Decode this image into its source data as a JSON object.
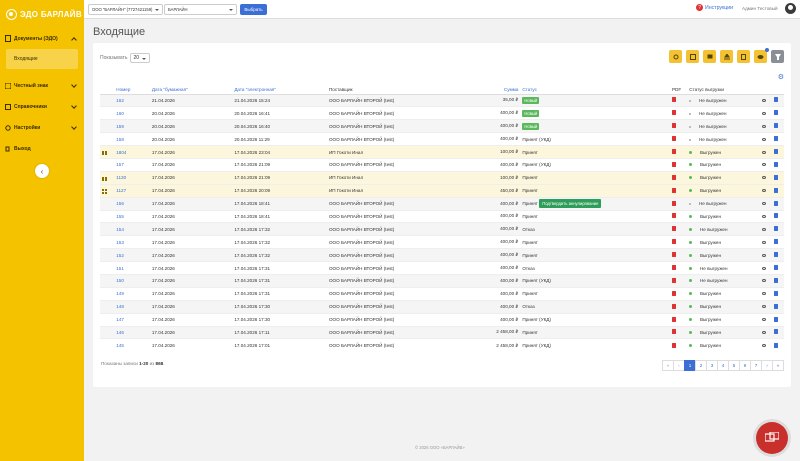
{
  "brand": {
    "name": "ЭДО БАРЛАЙВ"
  },
  "sidebar": {
    "items": [
      {
        "label": "Документы (ЭДО)",
        "icon": "document-icon"
      },
      {
        "label": "Входящие"
      },
      {
        "label": "Честный знак",
        "icon": "mark-icon"
      },
      {
        "label": "Справочники",
        "icon": "book-icon"
      },
      {
        "label": "Настройки",
        "icon": "settings-icon"
      },
      {
        "label": "Выход",
        "icon": "logout-icon"
      }
    ]
  },
  "topbar": {
    "org_select": "ООО \"БАРЛАЙН\" (7727421159)",
    "unit_select": "БАРЛАЙН",
    "choose_button": "Выбрать",
    "instructions": "Инструкции",
    "user": "Админ Тестовый"
  },
  "page": {
    "title": "Входящие"
  },
  "list": {
    "show_label": "Показывать",
    "page_size": "20",
    "columns": [
      "Номер",
      "Дата \"бумажная\"",
      "Дата \"электронная\"",
      "Поставщик",
      "Сумма",
      "Статус",
      "PDF",
      "Статус выгрузки"
    ],
    "rows": [
      {
        "num": "162",
        "d1": "21.04.2026",
        "d2": "21.04.2026 15:24",
        "sup": "ООО БАРЛАЙН ВТОРОЙ (test)",
        "sum": "35,00 ₽",
        "status": "Новый",
        "badge": true,
        "st_icon": false,
        "exp": "Не выгружен",
        "hl": false
      },
      {
        "num": "160",
        "d1": "20.04.2026",
        "d2": "20.04.2026 16:41",
        "sup": "ООО БАРЛАЙН ВТОРОЙ (test)",
        "sum": "400,00 ₽",
        "status": "Новый",
        "badge": true,
        "st_icon": false,
        "exp": "Не выгружен",
        "hl": false
      },
      {
        "num": "159",
        "d1": "20.04.2026",
        "d2": "20.04.2026 16:40",
        "sup": "ООО БАРЛАЙН ВТОРОЙ (test)",
        "sum": "400,00 ₽",
        "status": "Новый",
        "badge": true,
        "st_icon": false,
        "exp": "Не выгружен",
        "hl": false
      },
      {
        "num": "158",
        "d1": "20.04.2026",
        "d2": "20.04.2026 11:29",
        "sup": "ООО БАРЛАЙН ВТОРОЙ (test)",
        "sum": "400,00 ₽",
        "status": "Принят (УКД)",
        "badge": false,
        "st_icon": false,
        "exp": "Не выгружен",
        "hl": false
      },
      {
        "num": "1804",
        "d1": "17.04.2026",
        "d2": "17.04.2026 23:04",
        "sup": "ИП Гокоти Инал",
        "sum": "100,00 ₽",
        "status": "Принят",
        "badge": false,
        "st_icon": true,
        "exp": "Выгружен",
        "hl": true
      },
      {
        "num": "157",
        "d1": "17.04.2026",
        "d2": "17.04.2026 21:09",
        "sup": "ООО БАРЛАЙН ВТОРОЙ (test)",
        "sum": "400,00 ₽",
        "status": "Принят (УКД)",
        "badge": false,
        "st_icon": true,
        "exp": "Выгружен",
        "hl": false
      },
      {
        "num": "1130",
        "d1": "17.04.2026",
        "d2": "17.04.2026 21:09",
        "sup": "ИП Гокоти Инал",
        "sum": "100,00 ₽",
        "status": "Принят",
        "badge": false,
        "st_icon": true,
        "exp": "Выгружен",
        "hl": true
      },
      {
        "num": "1127",
        "d1": "17.04.2026",
        "d2": "17.04.2026 20:09",
        "sup": "ИП Гокоти Инал",
        "sum": "450,00 ₽",
        "status": "Принят",
        "badge": false,
        "st_icon": true,
        "exp": "Выгружен",
        "hl": true
      },
      {
        "num": "156",
        "d1": "17.04.2026",
        "d2": "17.04.2026 18:41",
        "sup": "ООО БАРЛАЙН ВТОРОЙ (test)",
        "sum": "400,00 ₽",
        "status": "Принят",
        "badge": false,
        "st_icon": false,
        "exp": "Не выгружен",
        "hl": false,
        "action": "Подтвердить аннулирование"
      },
      {
        "num": "155",
        "d1": "17.04.2026",
        "d2": "17.04.2026 18:41",
        "sup": "ООО БАРЛАЙН ВТОРОЙ (test)",
        "sum": "400,00 ₽",
        "status": "Принят",
        "badge": false,
        "st_icon": true,
        "exp": "Выгружен",
        "hl": false
      },
      {
        "num": "154",
        "d1": "17.04.2026",
        "d2": "17.04.2026 17:32",
        "sup": "ООО БАРЛАЙН ВТОРОЙ (test)",
        "sum": "400,00 ₽",
        "status": "Отказ",
        "badge": false,
        "st_icon": true,
        "exp": "Не выгружен",
        "hl": false
      },
      {
        "num": "153",
        "d1": "17.04.2026",
        "d2": "17.04.2026 17:32",
        "sup": "ООО БАРЛАЙН ВТОРОЙ (test)",
        "sum": "400,00 ₽",
        "status": "Принят",
        "badge": false,
        "st_icon": true,
        "exp": "Выгружен",
        "hl": false
      },
      {
        "num": "152",
        "d1": "17.04.2026",
        "d2": "17.04.2026 17:32",
        "sup": "ООО БАРЛАЙН ВТОРОЙ (test)",
        "sum": "400,00 ₽",
        "status": "Принят",
        "badge": false,
        "st_icon": true,
        "exp": "Выгружен",
        "hl": false
      },
      {
        "num": "151",
        "d1": "17.04.2026",
        "d2": "17.04.2026 17:31",
        "sup": "ООО БАРЛАЙН ВТОРОЙ (test)",
        "sum": "400,00 ₽",
        "status": "Отказ",
        "badge": false,
        "st_icon": true,
        "exp": "Не выгружен",
        "hl": false
      },
      {
        "num": "150",
        "d1": "17.04.2026",
        "d2": "17.04.2026 17:31",
        "sup": "ООО БАРЛАЙН ВТОРОЙ (test)",
        "sum": "400,00 ₽",
        "status": "Принят (УКД)",
        "badge": false,
        "st_icon": true,
        "exp": "Не выгружен",
        "hl": false
      },
      {
        "num": "149",
        "d1": "17.04.2026",
        "d2": "17.04.2026 17:31",
        "sup": "ООО БАРЛАЙН ВТОРОЙ (test)",
        "sum": "400,00 ₽",
        "status": "Принят",
        "badge": false,
        "st_icon": true,
        "exp": "Выгружен",
        "hl": false
      },
      {
        "num": "148",
        "d1": "17.04.2026",
        "d2": "17.04.2026 17:30",
        "sup": "ООО БАРЛАЙН ВТОРОЙ (test)",
        "sum": "400,00 ₽",
        "status": "Отказ",
        "badge": false,
        "st_icon": true,
        "exp": "Выгружен",
        "hl": false
      },
      {
        "num": "147",
        "d1": "17.04.2026",
        "d2": "17.04.2026 17:30",
        "sup": "ООО БАРЛАЙН ВТОРОЙ (test)",
        "sum": "400,00 ₽",
        "status": "Принят (УКД)",
        "badge": false,
        "st_icon": true,
        "exp": "Выгружен",
        "hl": false
      },
      {
        "num": "146",
        "d1": "17.04.2026",
        "d2": "17.04.2026 17:11",
        "sup": "ООО БАРЛАЙН ВТОРОЙ (test)",
        "sum": "2 458,00 ₽",
        "status": "Принят",
        "badge": false,
        "st_icon": true,
        "exp": "Выгружен",
        "hl": false
      },
      {
        "num": "145",
        "d1": "17.04.2026",
        "d2": "17.04.2026 17:01",
        "sup": "ООО БАРЛАЙН ВТОРОЙ (test)",
        "sum": "2 458,00 ₽",
        "status": "Принят (УКД)",
        "badge": false,
        "st_icon": true,
        "exp": "Выгружен",
        "hl": false
      }
    ],
    "footer": {
      "prefix": "Показаны записи ",
      "range": "1-20",
      "of": " из ",
      "total": "868",
      "suffix": "."
    },
    "pages": [
      "«",
      "‹",
      "1",
      "2",
      "3",
      "4",
      "5",
      "6",
      "7",
      "›",
      "»"
    ],
    "active_page": "1"
  },
  "copyright": "© 2026 ООО «БАРЛАЙВ»",
  "colors": {
    "accent": "#f5c200",
    "link": "#3b6fd6",
    "success": "#5cb85c",
    "danger": "#d33"
  }
}
